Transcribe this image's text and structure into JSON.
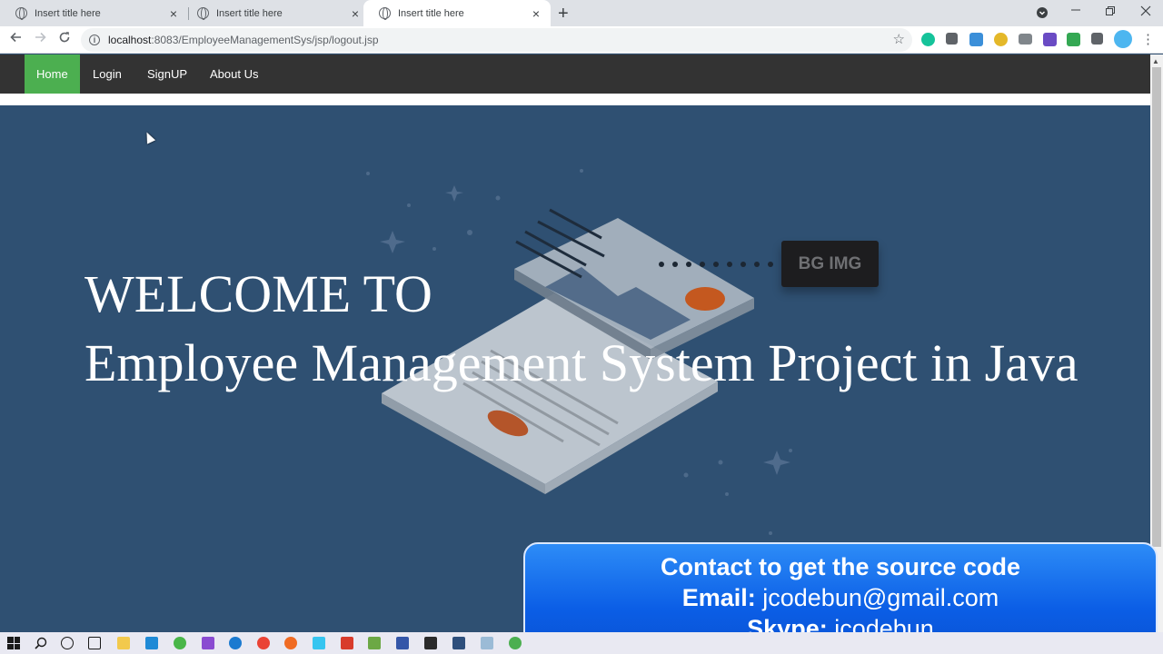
{
  "browser": {
    "tabs": [
      {
        "title": "Insert title here",
        "active": false
      },
      {
        "title": "Insert title here",
        "active": false
      },
      {
        "title": "Insert title here",
        "active": true
      }
    ],
    "url_host": "localhost",
    "url_path": ":8083/EmployeeManagementSys/jsp/logout.jsp",
    "new_tab_symbol": "+",
    "close_symbol": "×"
  },
  "nav": {
    "items": [
      {
        "label": "Home",
        "active": true
      },
      {
        "label": "Login",
        "active": false
      },
      {
        "label": "SignUP",
        "active": false
      },
      {
        "label": "About Us",
        "active": false
      }
    ]
  },
  "hero": {
    "line1": "WELCOME TO",
    "line2": "Employee Management System Project in Java",
    "bg_label": "BG IMG"
  },
  "contact": {
    "headline": "Contact to get the source code",
    "email_label": "Email:",
    "email_value": "jcodebun@gmail.com",
    "skype_label": "Skype:",
    "skype_value": "jcodebun"
  },
  "colors": {
    "nav_bg": "#333333",
    "nav_active": "#4caf50",
    "hero_bg": "#2f5072",
    "contact_bg": "#0b5ee6"
  },
  "icons": {
    "tab_icon": "globe-icon",
    "back": "arrow-left-icon",
    "forward": "arrow-right-icon",
    "reload": "reload-icon",
    "site_info": "info-icon",
    "bookmark": "star-icon"
  }
}
